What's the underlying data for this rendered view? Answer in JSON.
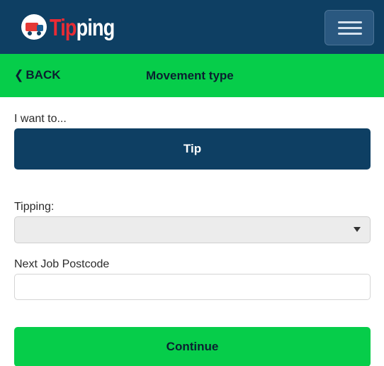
{
  "header": {
    "logo_text_red": "Tip",
    "logo_text_white": "ping",
    "menu_icon": "hamburger-icon",
    "colors": {
      "navy": "#0e3f63",
      "green": "#06cd4a",
      "red": "#ea2b34"
    }
  },
  "subheader": {
    "back_label": "BACK",
    "back_icon": "chevron-left-icon",
    "title": "Movement type"
  },
  "form": {
    "intent_label": "I want to...",
    "intent_button_label": "Tip",
    "tipping_label": "Tipping:",
    "tipping_selected": "",
    "postcode_label": "Next Job Postcode",
    "postcode_value": "",
    "continue_label": "Continue"
  }
}
